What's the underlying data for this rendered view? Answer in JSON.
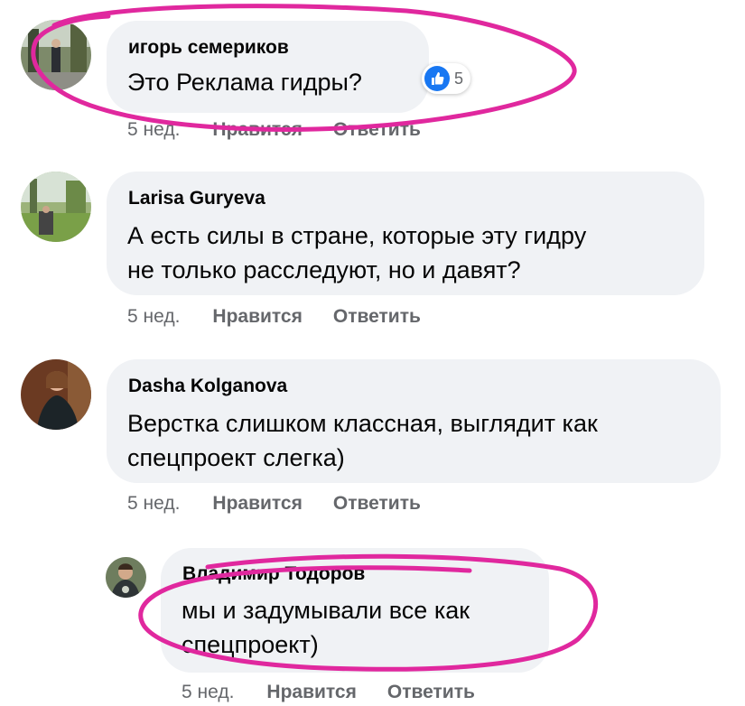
{
  "comments": [
    {
      "author": "игорь семериков",
      "lines": [
        "Это Реклама гидры?"
      ],
      "reaction_count": "5",
      "time": "5 нед.",
      "like": "Нравится",
      "reply": "Ответить"
    },
    {
      "author": "Larisa Guryeva",
      "lines": [
        "А есть силы в стране, которые эту гидру",
        "не только расследуют, но и давят?"
      ],
      "time": "5 нед.",
      "like": "Нравится",
      "reply": "Ответить"
    },
    {
      "author": "Dasha Kolganova",
      "lines": [
        "Верстка слишком классная, выглядит как",
        "спецпроект слегка)"
      ],
      "time": "5 нед.",
      "like": "Нравится",
      "reply": "Ответить"
    },
    {
      "author": "Владимир Тодоров",
      "lines": [
        "мы и задумывали все как",
        "спецпроект)"
      ],
      "time": "5 нед.",
      "like": "Нравится",
      "reply": "Ответить"
    }
  ],
  "icons": {
    "reaction": "thumbs-up-icon"
  },
  "colors": {
    "bubble": "#f0f2f5",
    "marker": "#e0289e",
    "like_blue": "#1877f2",
    "meta_gray": "#65676b"
  }
}
